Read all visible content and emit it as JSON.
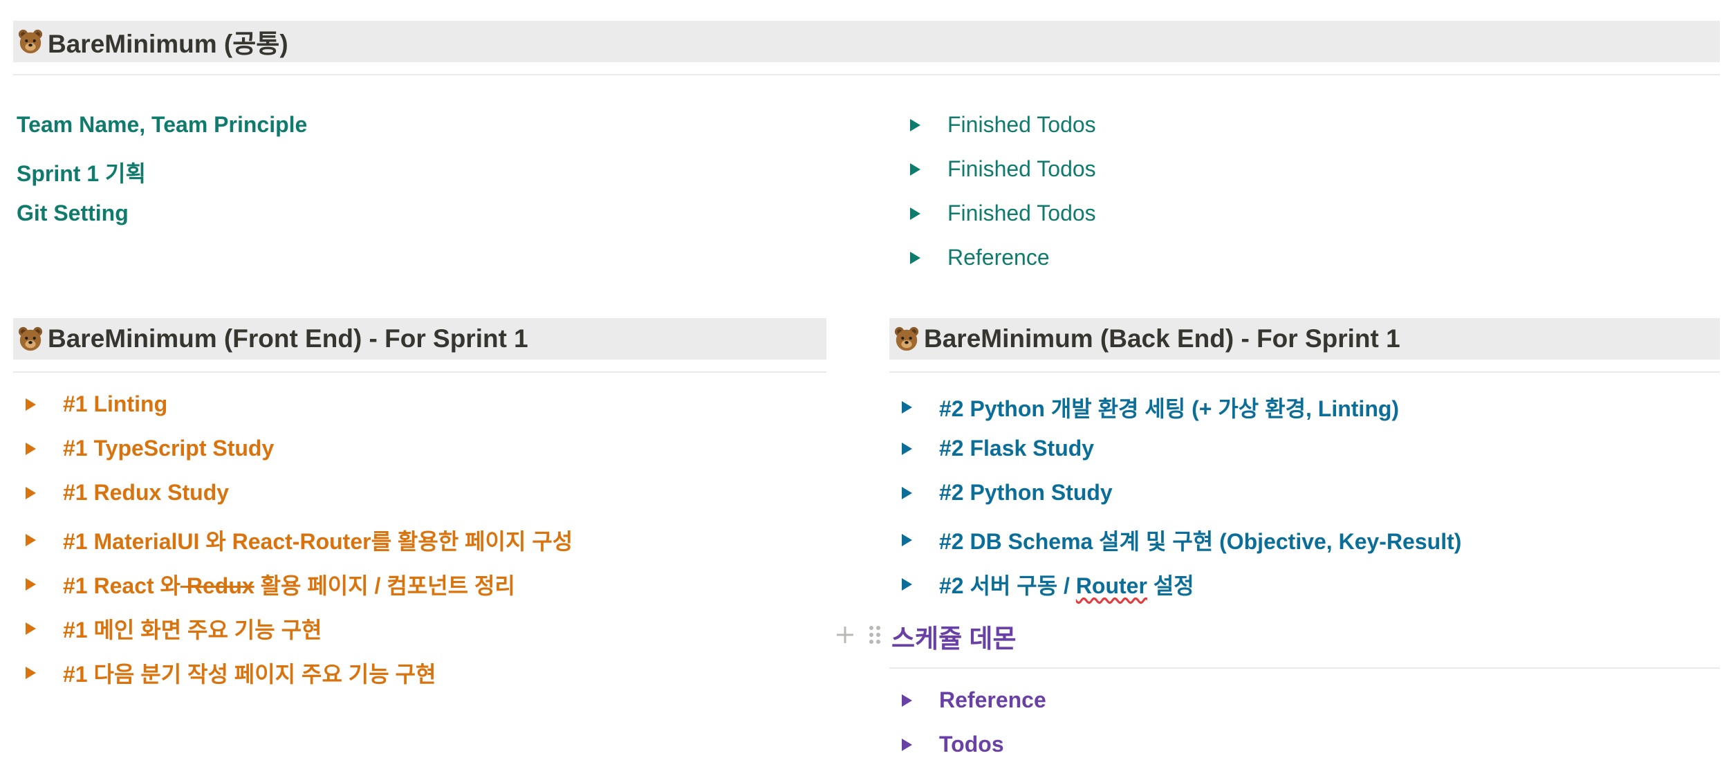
{
  "common": {
    "title": "BareMinimum (공통)",
    "links": [
      "Team Name, Team Principle",
      "Sprint 1 기획",
      "Git Setting"
    ],
    "toggles": [
      "Finished Todos",
      "Finished Todos",
      "Finished Todos",
      "Reference"
    ]
  },
  "frontend": {
    "title": "BareMinimum (Front End) - For Sprint 1",
    "items": [
      "#1 Linting",
      "#1 TypeScript Study",
      "#1 Redux Study",
      "#1 MaterialUI 와 React-Router를 활용한 페이지 구성",
      {
        "prefix": "#1 React 와",
        "struck": " Redux",
        "suffix": " 활용 페이지 / 컴포넌트 정리"
      },
      "#1 메인 화면 주요 기능 구현",
      "#1 다음 분기 작성 페이지 주요 기능 구현"
    ]
  },
  "backend": {
    "title": "BareMinimum (Back End) - For Sprint 1",
    "items": [
      "#2 Python 개발 환경 세팅 (+ 가상 환경, Linting)",
      "#2 Flask Study",
      "#2 Python Study",
      "#2 DB Schema 설계 및 구현 (Objective, Key-Result)",
      {
        "prefix": "#2 서버 구동 / ",
        "misspelled": "Router",
        "suffix": " 설정"
      }
    ]
  },
  "schedule": {
    "title": "스케쥴 데몬",
    "items": [
      "Reference",
      "Todos"
    ]
  },
  "colors": {
    "green": "#0f7b6c",
    "orange": "#d9730d",
    "blue": "#0b6e99",
    "purple": "#6940a5",
    "header_bg": "#ebebeb"
  },
  "icons": {
    "bear": "bear-face-icon",
    "toggle": "triangle-right-icon",
    "add": "plus-icon",
    "drag": "drag-handle-icon"
  }
}
